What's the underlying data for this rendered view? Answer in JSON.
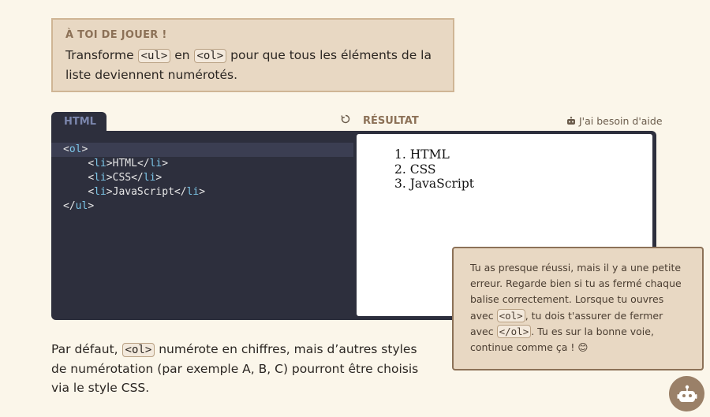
{
  "task": {
    "title": "À TOI DE JOUER !",
    "text_before": "Transforme ",
    "tag_ul": "<ul>",
    "text_mid": " en ",
    "tag_ol": "<ol>",
    "text_after": " pour que tous les éléments de la liste deviennent numérotés."
  },
  "editor": {
    "tab_label": "HTML",
    "reset_icon": "reset-icon",
    "result_label": "RÉSULTAT",
    "help_label": "J'ai besoin d'aide",
    "code_lines": [
      {
        "indent": "",
        "open": "<",
        "tag": "ol",
        "close": ">"
      },
      {
        "indent": "    ",
        "open": "<",
        "tag": "li",
        "close": ">",
        "text": "HTML",
        "end_open": "</",
        "end_tag": "li",
        "end_close": ">"
      },
      {
        "indent": "    ",
        "open": "<",
        "tag": "li",
        "close": ">",
        "text": "CSS",
        "end_open": "</",
        "end_tag": "li",
        "end_close": ">"
      },
      {
        "indent": "    ",
        "open": "<",
        "tag": "li",
        "close": ">",
        "text": "JavaScript",
        "end_open": "</",
        "end_tag": "li",
        "end_close": ">"
      },
      {
        "indent": "",
        "open": "</",
        "tag": "ul",
        "close": ">"
      }
    ]
  },
  "result": {
    "items": [
      "1. HTML",
      "2. CSS",
      "3. JavaScript"
    ]
  },
  "bottom": {
    "text_before": "Par défaut, ",
    "tag_ol": "<ol>",
    "text_after": " numérote en chiffres, mais d’autres styles de numérotation (par exemple A, B, C) pourront être choisis via le style CSS."
  },
  "hint": {
    "text_1": "Tu as presque réussi, mais il y a une petite erreur. Regarde bien si tu as fermé chaque balise correctement. Lorsque tu ouvres avec ",
    "tag_open": "<ol>",
    "text_2": ", tu dois t'assurer de fermer avec ",
    "tag_close": "</ol>",
    "text_3": ". Tu es sur la bonne voie, continue comme ça ! 😊"
  },
  "colors": {
    "background": "#fbf6ea",
    "editor_bg": "#2d2f3d",
    "task_bg": "#e8d8c3",
    "accent_brown": "#8c7157",
    "tag_color": "#7cc6e8"
  },
  "assistant_icon": "robot-icon"
}
